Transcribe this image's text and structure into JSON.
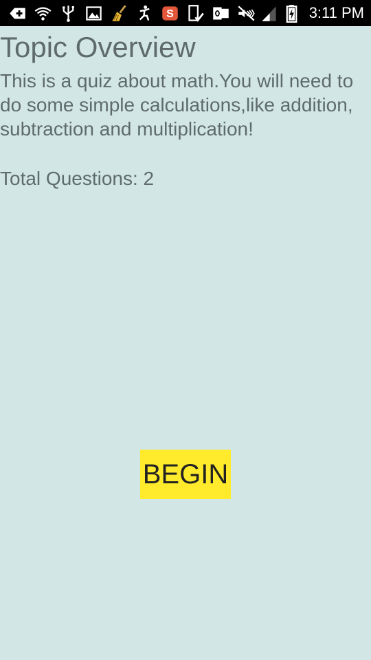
{
  "status_bar": {
    "time": "3:11 PM",
    "icons": [
      "add-icon",
      "wifi-question-icon",
      "usb-icon",
      "image-icon",
      "broom-icon",
      "accessibility-icon",
      "s-app-icon",
      "tablet-check-icon",
      "outlook-icon",
      "mute-icon",
      "signal-icon",
      "battery-charging-icon"
    ]
  },
  "main": {
    "title": "Topic Overview",
    "description": "This is a quiz about math.You will need to do some simple calculations,like addition, subtraction and multiplication!",
    "total_questions": "Total Questions: 2",
    "begin_label": "BEGIN"
  },
  "colors": {
    "background": "#d2e7e5",
    "text": "#5f6b6b",
    "button": "#ffeb2b",
    "status_bar": "#000000"
  }
}
